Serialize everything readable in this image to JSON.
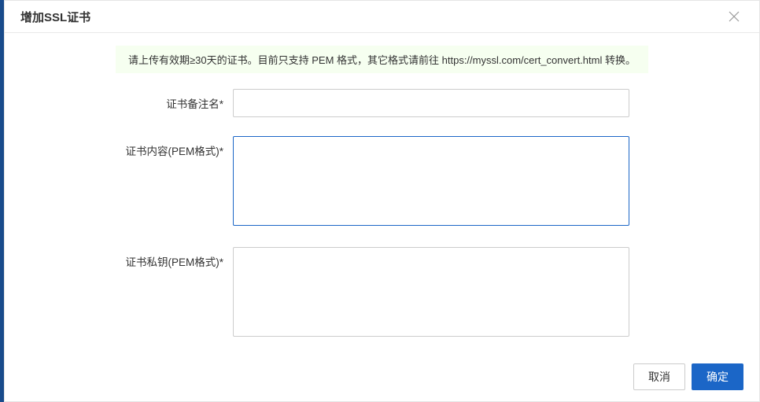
{
  "modal": {
    "title": "增加SSL证书",
    "info_banner": "请上传有效期≥30天的证书。目前只支持 PEM 格式，其它格式请前往 https://myssl.com/cert_convert.html 转换。"
  },
  "form": {
    "cert_name": {
      "label": "证书备注名*",
      "value": ""
    },
    "cert_content": {
      "label": "证书内容(PEM格式)*",
      "value": ""
    },
    "cert_private_key": {
      "label": "证书私钥(PEM格式)*",
      "value": ""
    }
  },
  "footer": {
    "cancel_label": "取消",
    "confirm_label": "确定"
  }
}
